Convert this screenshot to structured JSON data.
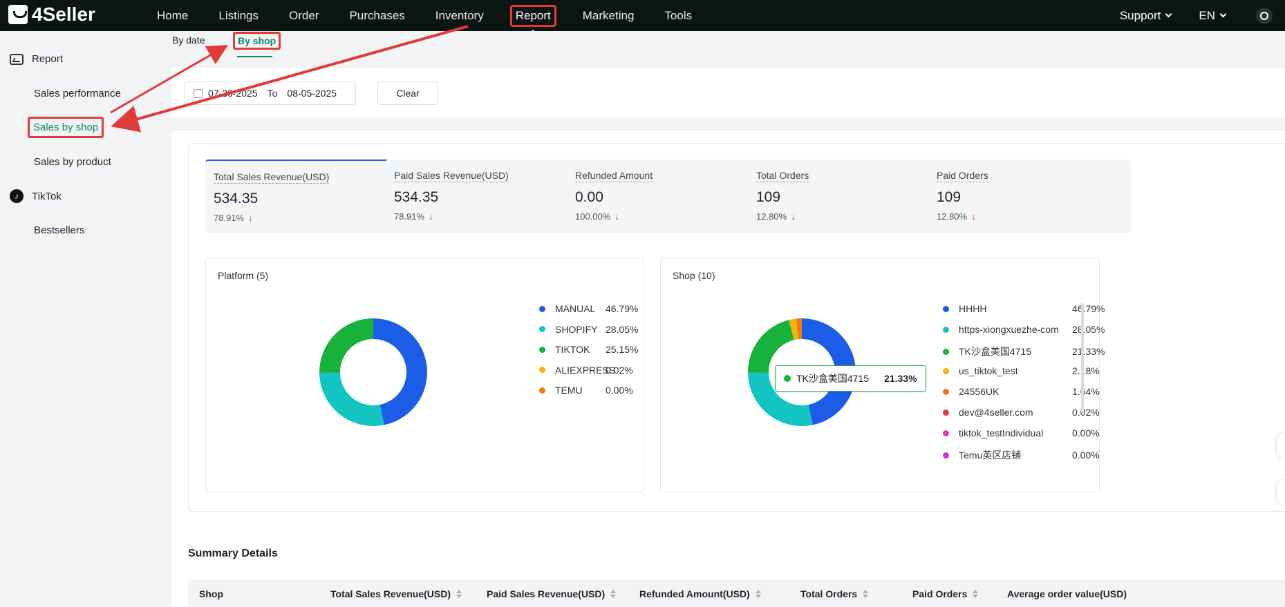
{
  "brand": {
    "name": "4Seller"
  },
  "nav": {
    "items": [
      "Home",
      "Listings",
      "Order",
      "Purchases",
      "Inventory",
      "Report",
      "Marketing",
      "Tools"
    ],
    "active": "Report",
    "support": "Support",
    "language": "EN"
  },
  "sidebar": {
    "report_label": "Report",
    "items": [
      "Sales performance",
      "Sales by shop",
      "Sales by product"
    ],
    "tiktok_label": "TikTok",
    "bestsellers": "Bestsellers"
  },
  "subtabs": {
    "by_date": "By date",
    "by_shop": "By shop"
  },
  "filter": {
    "start_date": "07-30-2025",
    "to_label": "To",
    "end_date": "08-05-2025",
    "clear_label": "Clear"
  },
  "kpis": [
    {
      "label": "Total Sales Revenue(USD)",
      "value": "534.35",
      "pct": "78.91%"
    },
    {
      "label": "Paid Sales Revenue(USD)",
      "value": "534.35",
      "pct": "78.91%"
    },
    {
      "label": "Refunded Amount",
      "value": "0.00",
      "pct": "100.00%"
    },
    {
      "label": "Total Orders",
      "value": "109",
      "pct": "12.80%"
    },
    {
      "label": "Paid Orders",
      "value": "109",
      "pct": "12.80%"
    }
  ],
  "platform_chart": {
    "title": "Platform (5)",
    "legend": [
      {
        "name": "MANUAL",
        "pct": "46.79%",
        "value": 46.79,
        "color": "#1c5de8"
      },
      {
        "name": "SHOPIFY",
        "pct": "28.05%",
        "value": 28.05,
        "color": "#12c5c2"
      },
      {
        "name": "TIKTOK",
        "pct": "25.15%",
        "value": 25.15,
        "color": "#17b23a"
      },
      {
        "name": "ALIEXPRESS",
        "pct": "0.02%",
        "value": 0.02,
        "color": "#f5b40a"
      },
      {
        "name": "TEMU",
        "pct": "0.00%",
        "value": 0.0,
        "color": "#f07a12"
      }
    ]
  },
  "shop_chart": {
    "title": "Shop (10)",
    "legend": [
      {
        "name": "HHHH",
        "pct": "46.79%",
        "value": 46.79,
        "color": "#1c5de8"
      },
      {
        "name": "https-xiongxuezhe-com",
        "pct": "28.05%",
        "value": 28.05,
        "color": "#12c5c2"
      },
      {
        "name": "TK沙盒美国4715",
        "pct": "21.33%",
        "value": 21.33,
        "color": "#17b23a"
      },
      {
        "name": "us_tiktok_test",
        "pct": "2.18%",
        "value": 2.18,
        "color": "#f5b40a"
      },
      {
        "name": "24556UK",
        "pct": "1.64%",
        "value": 1.64,
        "color": "#f07a12"
      },
      {
        "name": "dev@4seller.com",
        "pct": "0.02%",
        "value": 0.02,
        "color": "#e83a3a"
      },
      {
        "name": "tiktok_testIndividual",
        "pct": "0.00%",
        "value": 0.0,
        "color": "#e83ab0"
      },
      {
        "name": "Temu英区店铺",
        "pct": "0.00%",
        "value": 0.0,
        "color": "#c83ad8"
      }
    ],
    "tooltip": {
      "name": "TK沙盒美国4715",
      "pct": "21.33%",
      "color": "#17b23a"
    }
  },
  "summary": {
    "title": "Summary Details",
    "columns": [
      "Shop",
      "Total Sales Revenue(USD)",
      "Paid Sales Revenue(USD)",
      "Refunded Amount(USD)",
      "Total Orders",
      "Paid Orders",
      "Average order value(USD)"
    ]
  },
  "annotation_color": "#e23a3a"
}
